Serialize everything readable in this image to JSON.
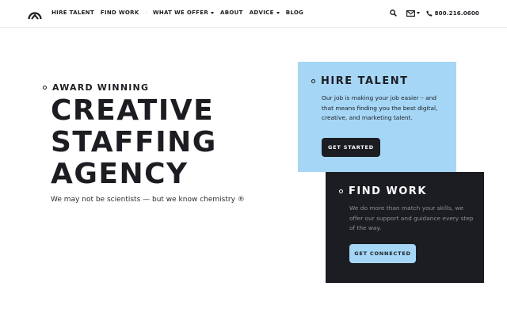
{
  "nav": {
    "links": [
      {
        "label": "HIRE TALENT",
        "dropdown": false
      },
      {
        "label": "FIND WORK",
        "dropdown": false
      },
      {
        "label": "WHAT WE OFFER",
        "dropdown": true
      },
      {
        "label": "ABOUT",
        "dropdown": false
      },
      {
        "label": "ADVICE",
        "dropdown": true
      },
      {
        "label": "BLOG",
        "dropdown": false
      }
    ],
    "separator": "·",
    "icons": [
      "logo-arch-icon",
      "search-icon",
      "envelope-icon",
      "phone-icon"
    ],
    "phone": "800.216.0600"
  },
  "hero": {
    "eyebrow": "AWARD WINNING",
    "title_lines": [
      "CREATIVE",
      "STAFFING",
      "AGENCY"
    ],
    "subtitle": "We may not be scientists — but we know chemistry ®"
  },
  "cards": {
    "hire": {
      "title": "HIRE TALENT",
      "body": "Our job is making your job easier – and that means finding you the best digital, creative, and marketing talent.",
      "button": "GET STARTED"
    },
    "work": {
      "title": "FIND WORK",
      "body": "We do more than match your skills, we offer our support and guidance every step of the way.",
      "button": "GET CONNECTED"
    }
  },
  "colors": {
    "accent_blue": "#a5d6f6",
    "dark": "#1c1d22"
  }
}
